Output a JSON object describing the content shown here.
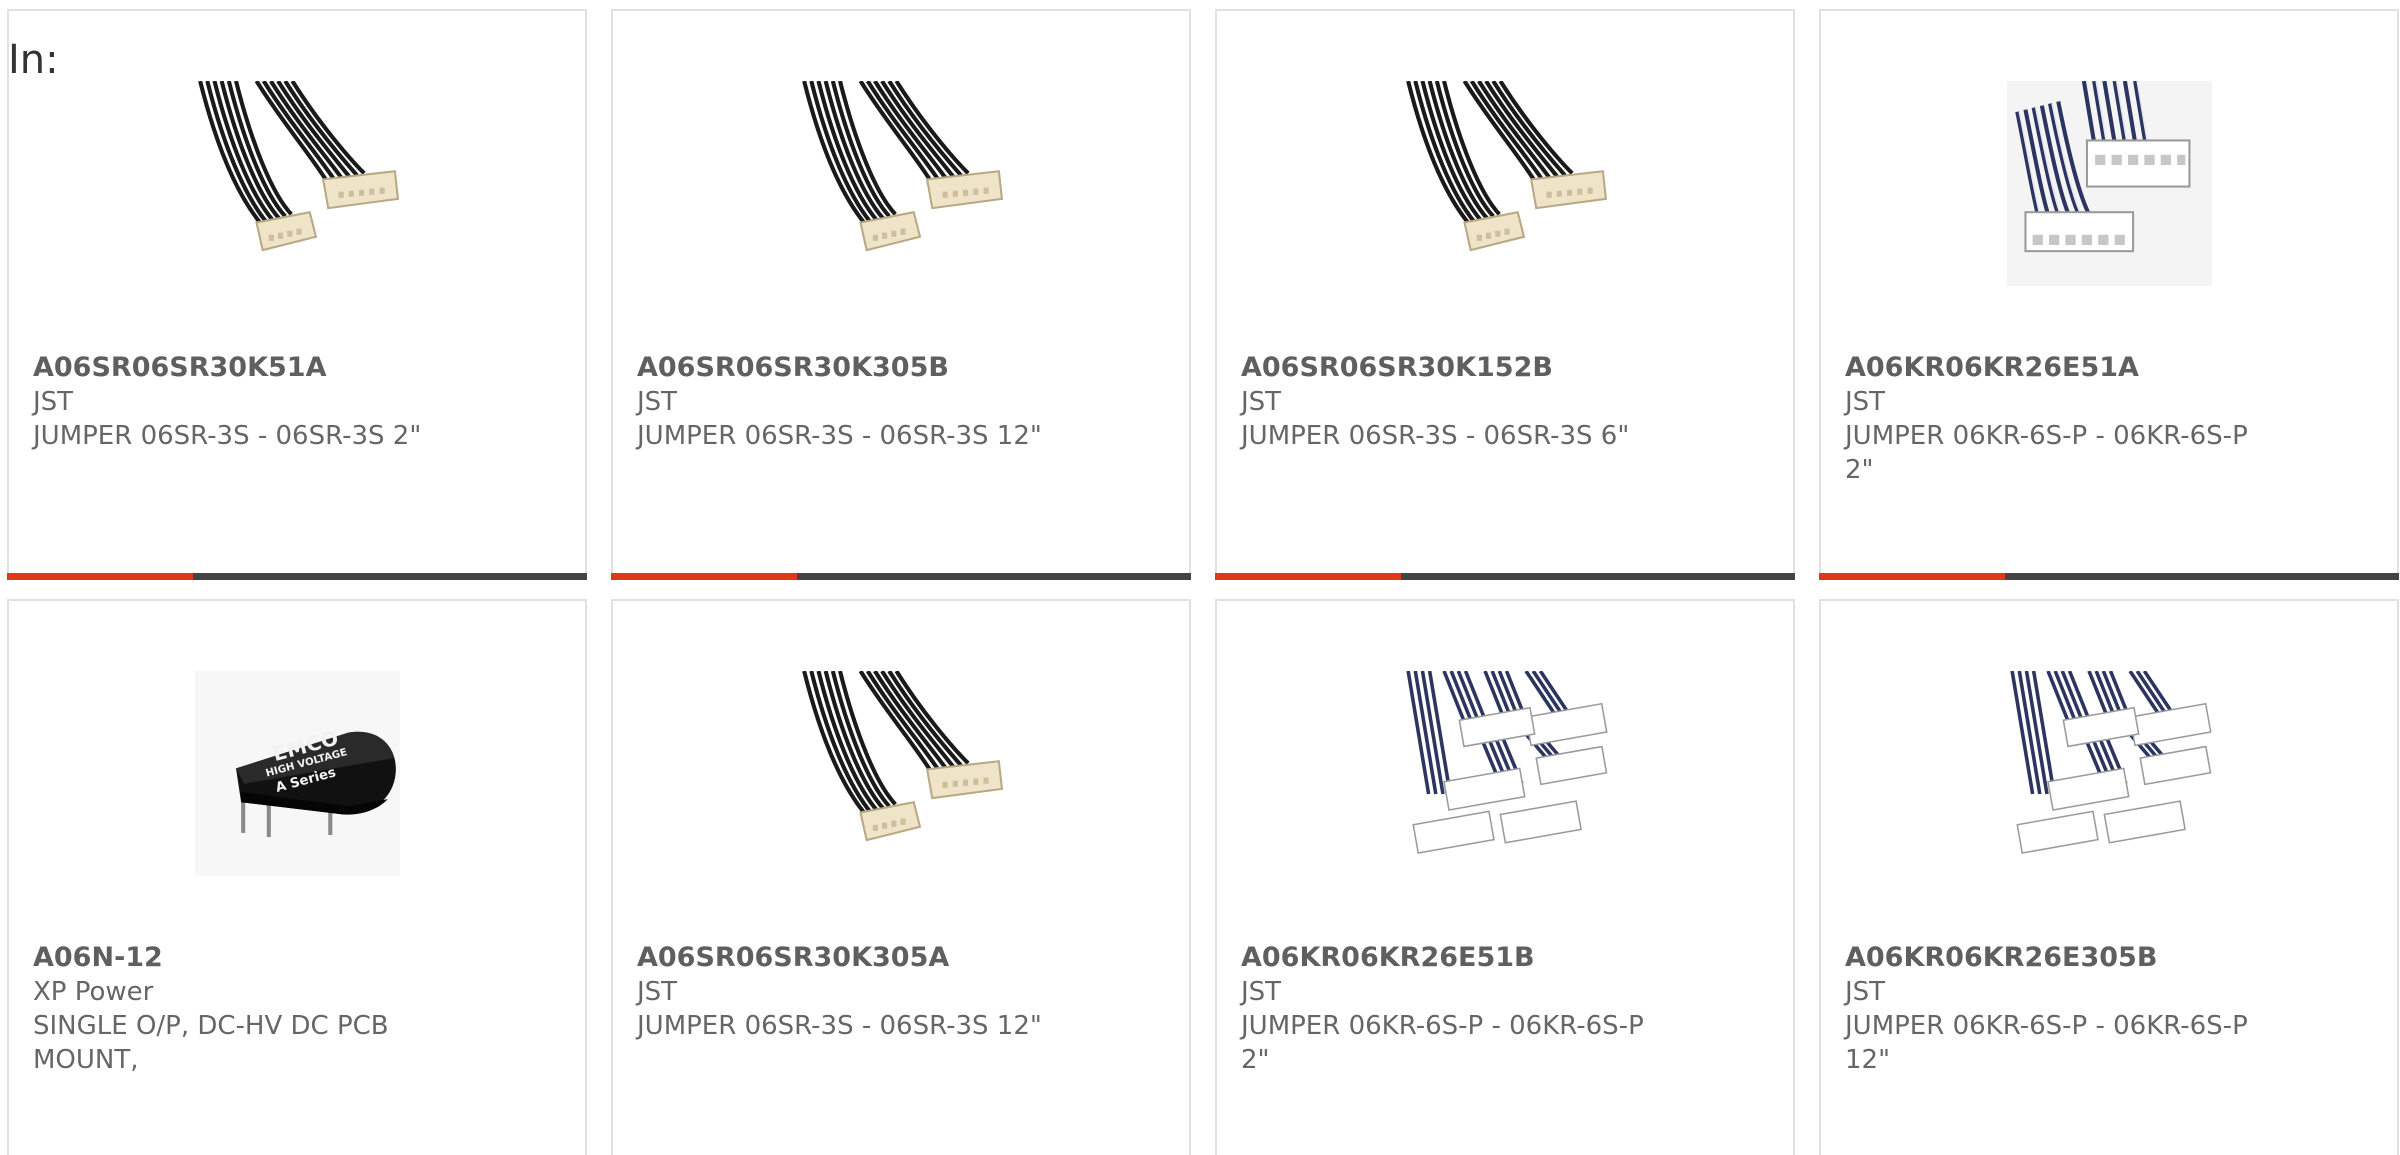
{
  "header": {
    "in_label": "In:"
  },
  "accent_color": "#e03a14",
  "bar_color": "#444444",
  "products": [
    {
      "part_number": "A06SR06SR30K51A",
      "manufacturer": "JST",
      "description": "JUMPER 06SR-3S - 06SR-3S 2\"",
      "image": "black-cable-jumper-image",
      "progress": 0.32
    },
    {
      "part_number": "A06SR06SR30K305B",
      "manufacturer": "JST",
      "description": "JUMPER 06SR-3S - 06SR-3S 12\"",
      "image": "black-cable-jumper-image",
      "progress": 0.32
    },
    {
      "part_number": "A06SR06SR30K152B",
      "manufacturer": "JST",
      "description": "JUMPER 06SR-3S - 06SR-3S 6\"",
      "image": "black-cable-jumper-image",
      "progress": 0.32
    },
    {
      "part_number": "A06KR06KR26E51A",
      "manufacturer": "JST",
      "description": "JUMPER 06KR-6S-P - 06KR-6S-P 2\"",
      "image": "white-connector-jumper-image",
      "progress": 0.32
    },
    {
      "part_number": "A06N-12",
      "manufacturer": "XP Power",
      "description": "SINGLE O/P, DC-HV DC PCB MOUNT,",
      "image": "emco-module-image",
      "image_text": [
        "EMCO",
        "HIGH VOLTAGE",
        "A Series"
      ]
    },
    {
      "part_number": "A06SR06SR30K305A",
      "manufacturer": "JST",
      "description": "JUMPER 06SR-3S - 06SR-3S 12\"",
      "image": "black-cable-jumper-image"
    },
    {
      "part_number": "A06KR06KR26E51B",
      "manufacturer": "JST",
      "description": "JUMPER 06KR-6S-P - 06KR-6S-P 2\"",
      "image": "multi-connector-jumper-image"
    },
    {
      "part_number": "A06KR06KR26E305B",
      "manufacturer": "JST",
      "description": "JUMPER 06KR-6S-P - 06KR-6S-P 12\"",
      "image": "multi-connector-jumper-image"
    }
  ]
}
